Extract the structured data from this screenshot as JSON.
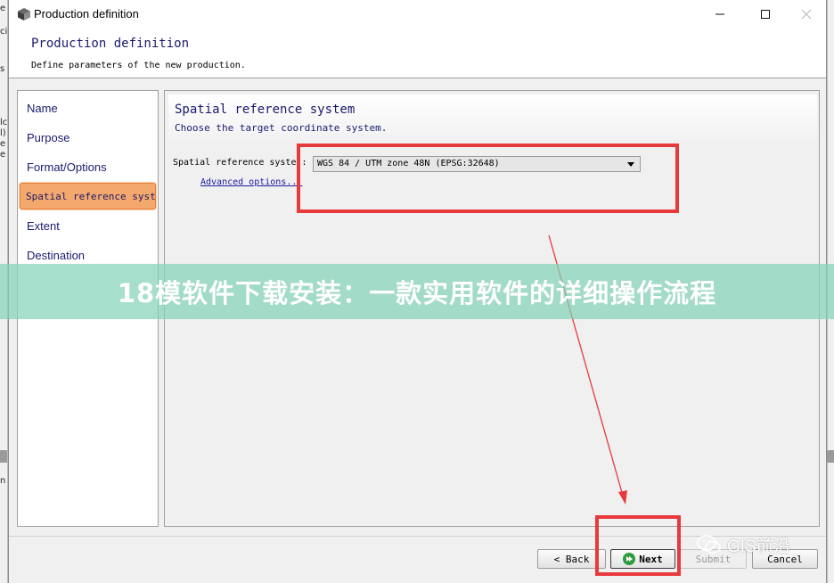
{
  "window": {
    "title": "Production definition",
    "minimize_icon": "minimize-icon",
    "maximize_icon": "maximize-icon",
    "close_icon": "close-icon"
  },
  "header": {
    "title": "Production definition",
    "subtitle": "Define parameters of the new production."
  },
  "nav": {
    "items": [
      {
        "label": "Name"
      },
      {
        "label": "Purpose"
      },
      {
        "label": "Format/Options"
      },
      {
        "label": "Spatial reference syst…",
        "active": true
      },
      {
        "label": "Extent"
      },
      {
        "label": "Destination"
      }
    ],
    "active_color": "#f4a86b"
  },
  "panel": {
    "title": "Spatial reference system",
    "subtitle": "Choose the target coordinate system.",
    "srs_label": "Spatial reference syste :",
    "srs_value": "WGS 84 / UTM zone 48N (EPSG:32648)",
    "advanced_link": "Advanced options..."
  },
  "footer": {
    "back": "< Back",
    "next": "Next",
    "submit": "Submit",
    "cancel": "Cancel"
  },
  "overlay": {
    "banner": "18模软件下载安装：一款实用软件的详细操作流程",
    "brand": "GIS前沿",
    "annotation_color": "#e8393d"
  }
}
